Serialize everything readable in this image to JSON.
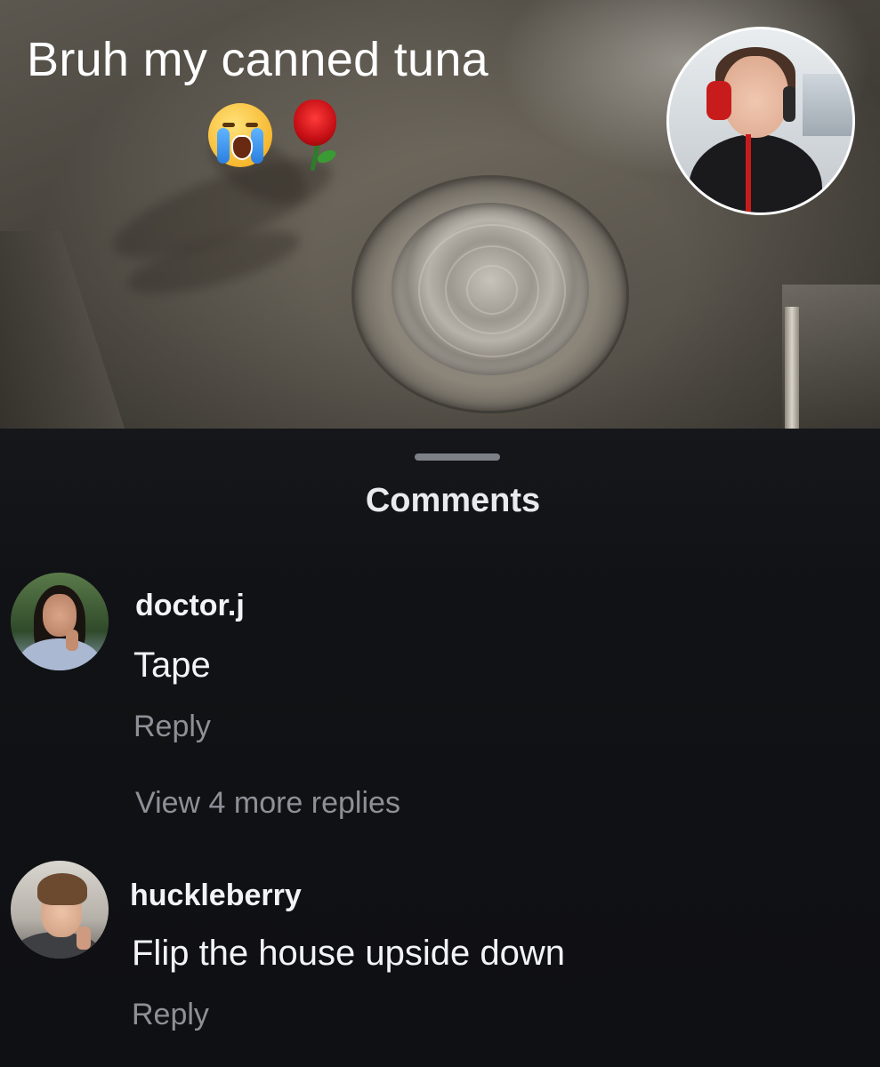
{
  "post": {
    "caption": "Bruh my canned tuna",
    "emojis": [
      "loudly-crying-face-emoji",
      "rose-emoji"
    ]
  },
  "comments_sheet": {
    "title": "Comments",
    "comments": [
      {
        "username": "doctor.j",
        "text": "Tape",
        "reply_label": "Reply",
        "view_more_label": "View 4 more replies"
      },
      {
        "username": "huckleberry",
        "text": "Flip the house upside down",
        "reply_label": "Reply"
      }
    ]
  }
}
